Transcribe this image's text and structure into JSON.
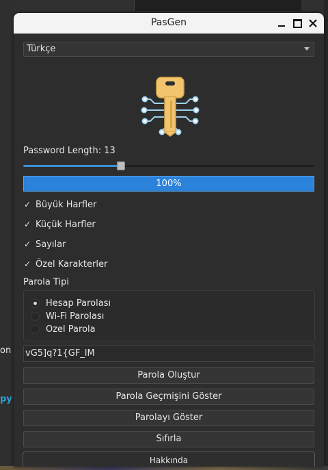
{
  "desktop": {
    "left_snippets": [
      "on",
      "py"
    ]
  },
  "window": {
    "title": "PasGen"
  },
  "language": {
    "selected": "Türkçe"
  },
  "logo": {
    "icon": "key-circuit-icon",
    "colors": {
      "key": "#f2c46d",
      "circuit": "#9fd3f0"
    }
  },
  "length": {
    "label": "Password Length: 13",
    "value": 13,
    "slider_fraction": 0.33
  },
  "progress": {
    "text": "100%",
    "value": 100
  },
  "options": [
    {
      "label": "Büyük Harfler",
      "checked": true,
      "mark": "✓"
    },
    {
      "label": "Küçük Harfler",
      "checked": true,
      "mark": "✓"
    },
    {
      "label": "Sayılar",
      "checked": true,
      "mark": "✓"
    },
    {
      "label": "Özel Karakterler",
      "checked": true,
      "mark": "✓"
    }
  ],
  "password_type": {
    "title": "Parola Tipi",
    "choices": [
      {
        "label": "Hesap Parolası",
        "selected": true
      },
      {
        "label": "Wi-Fi Parolası",
        "selected": false
      },
      {
        "label": "Ozel Parola",
        "selected": false
      }
    ]
  },
  "output": {
    "password": "vG5]q?1{GF_lM"
  },
  "buttons": {
    "generate": "Parola Oluştur",
    "history": "Parola Geçmişini Göster",
    "show": "Parolayı Göster",
    "reset": "Sıfırla",
    "about": "Hakkında"
  },
  "colors": {
    "accent": "#2a82da",
    "background": "#2d2d2d",
    "text": "#e6e6e6"
  }
}
